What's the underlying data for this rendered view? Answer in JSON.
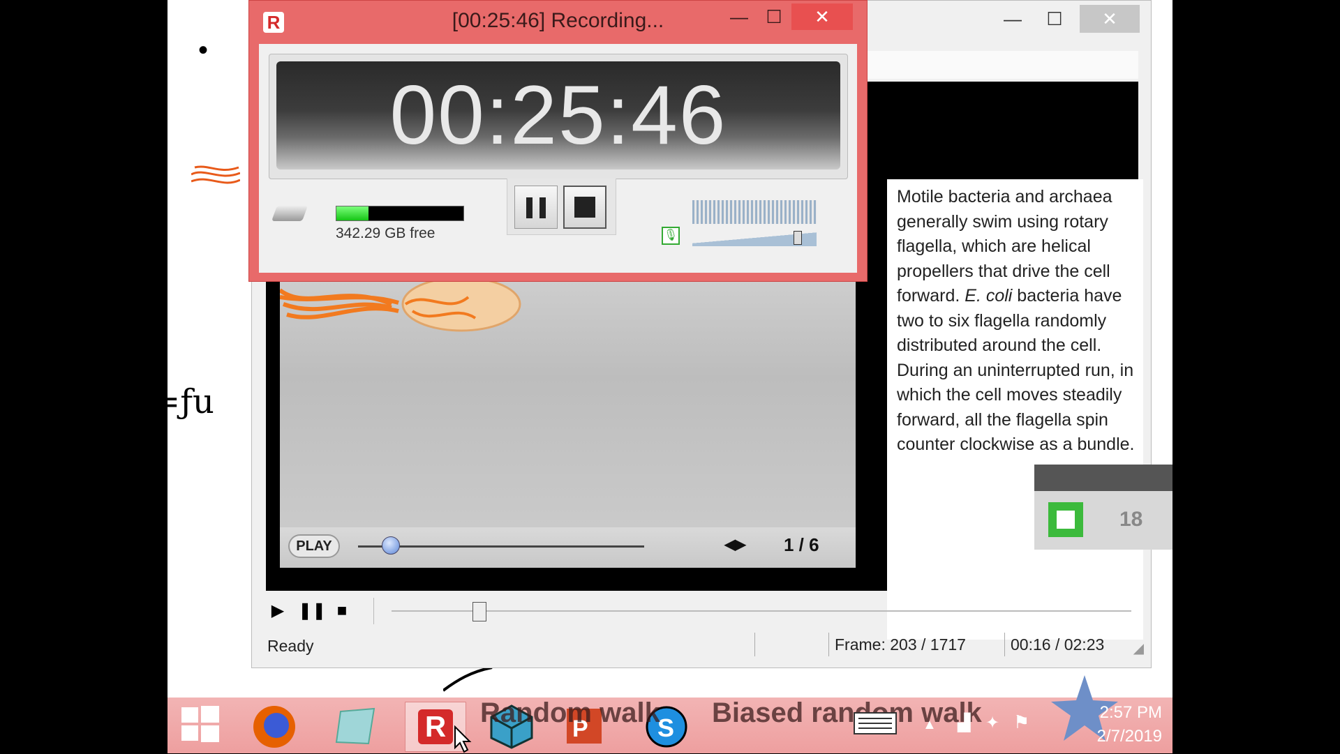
{
  "recorder": {
    "title": "[00:25:46] Recording...",
    "timer": "00:25:46",
    "disk_free": "342.29 GB free",
    "disk_used_fraction": 0.25
  },
  "player": {
    "status": "Ready",
    "frame": "Frame: 203 / 1717",
    "time": "00:16 / 02:23",
    "seek_fraction": 0.1
  },
  "animation": {
    "play_label": "PLAY",
    "page_indicator": "1 / 6",
    "text_before_italic": "Motile bacteria and archaea generally swim using rotary flagella, which are helical propellers that drive the cell forward. ",
    "italic": "E. coli",
    "text_after_italic": " bacteria have two to six flagella randomly distributed around the cell. During an uninterrupted run, in which the cell moves steadily forward, all the flagella spin counter clockwise as a bundle."
  },
  "widget": {
    "number": "18"
  },
  "taskbar": {
    "overlay_text_1": "Random walk",
    "overlay_text_2": "Biased random walk",
    "time": "2:57 PM",
    "date": "2/7/2019"
  },
  "whiteboard": {
    "bullet": "•",
    "annotation": "=ƒu"
  },
  "colors": {
    "recorder_frame": "#e86a6a",
    "taskbar": "#f0a8a8",
    "disk_fill": "#16c516"
  }
}
